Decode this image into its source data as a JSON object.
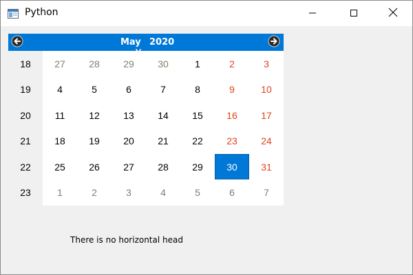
{
  "window": {
    "title": "Python",
    "app_icon": "python-app-icon",
    "controls": {
      "minimize": "minimize-icon",
      "maximize": "maximize-icon",
      "close": "close-icon"
    }
  },
  "calendar": {
    "month": "May",
    "year": "2020",
    "accent_color": "#0078d7",
    "weekend_color": "#e0411a",
    "other_month_color": "#7f7f6a",
    "nav": {
      "prev_icon": "arrow-left-circle-icon",
      "next_icon": "arrow-right-circle-icon"
    },
    "week_numbers": [
      "18",
      "19",
      "20",
      "21",
      "22",
      "23"
    ],
    "weeks": [
      [
        {
          "d": "27",
          "t": "other"
        },
        {
          "d": "28",
          "t": "other"
        },
        {
          "d": "29",
          "t": "other"
        },
        {
          "d": "30",
          "t": "other"
        },
        {
          "d": "1",
          "t": "current"
        },
        {
          "d": "2",
          "t": "weekend"
        },
        {
          "d": "3",
          "t": "weekend"
        }
      ],
      [
        {
          "d": "4",
          "t": "current"
        },
        {
          "d": "5",
          "t": "current"
        },
        {
          "d": "6",
          "t": "current"
        },
        {
          "d": "7",
          "t": "current"
        },
        {
          "d": "8",
          "t": "current"
        },
        {
          "d": "9",
          "t": "weekend"
        },
        {
          "d": "10",
          "t": "weekend"
        }
      ],
      [
        {
          "d": "11",
          "t": "current"
        },
        {
          "d": "12",
          "t": "current"
        },
        {
          "d": "13",
          "t": "current"
        },
        {
          "d": "14",
          "t": "current"
        },
        {
          "d": "15",
          "t": "current"
        },
        {
          "d": "16",
          "t": "weekend"
        },
        {
          "d": "17",
          "t": "weekend"
        }
      ],
      [
        {
          "d": "18",
          "t": "current"
        },
        {
          "d": "19",
          "t": "current"
        },
        {
          "d": "20",
          "t": "current"
        },
        {
          "d": "21",
          "t": "current"
        },
        {
          "d": "22",
          "t": "current"
        },
        {
          "d": "23",
          "t": "weekend"
        },
        {
          "d": "24",
          "t": "weekend"
        }
      ],
      [
        {
          "d": "25",
          "t": "current"
        },
        {
          "d": "26",
          "t": "current"
        },
        {
          "d": "27",
          "t": "current"
        },
        {
          "d": "28",
          "t": "current"
        },
        {
          "d": "29",
          "t": "current"
        },
        {
          "d": "30",
          "t": "selected"
        },
        {
          "d": "31",
          "t": "weekend"
        }
      ],
      [
        {
          "d": "1",
          "t": "other"
        },
        {
          "d": "2",
          "t": "other"
        },
        {
          "d": "3",
          "t": "other"
        },
        {
          "d": "4",
          "t": "other"
        },
        {
          "d": "5",
          "t": "other"
        },
        {
          "d": "6",
          "t": "other"
        },
        {
          "d": "7",
          "t": "other"
        }
      ]
    ]
  },
  "status_label": "There is no horizontal head"
}
